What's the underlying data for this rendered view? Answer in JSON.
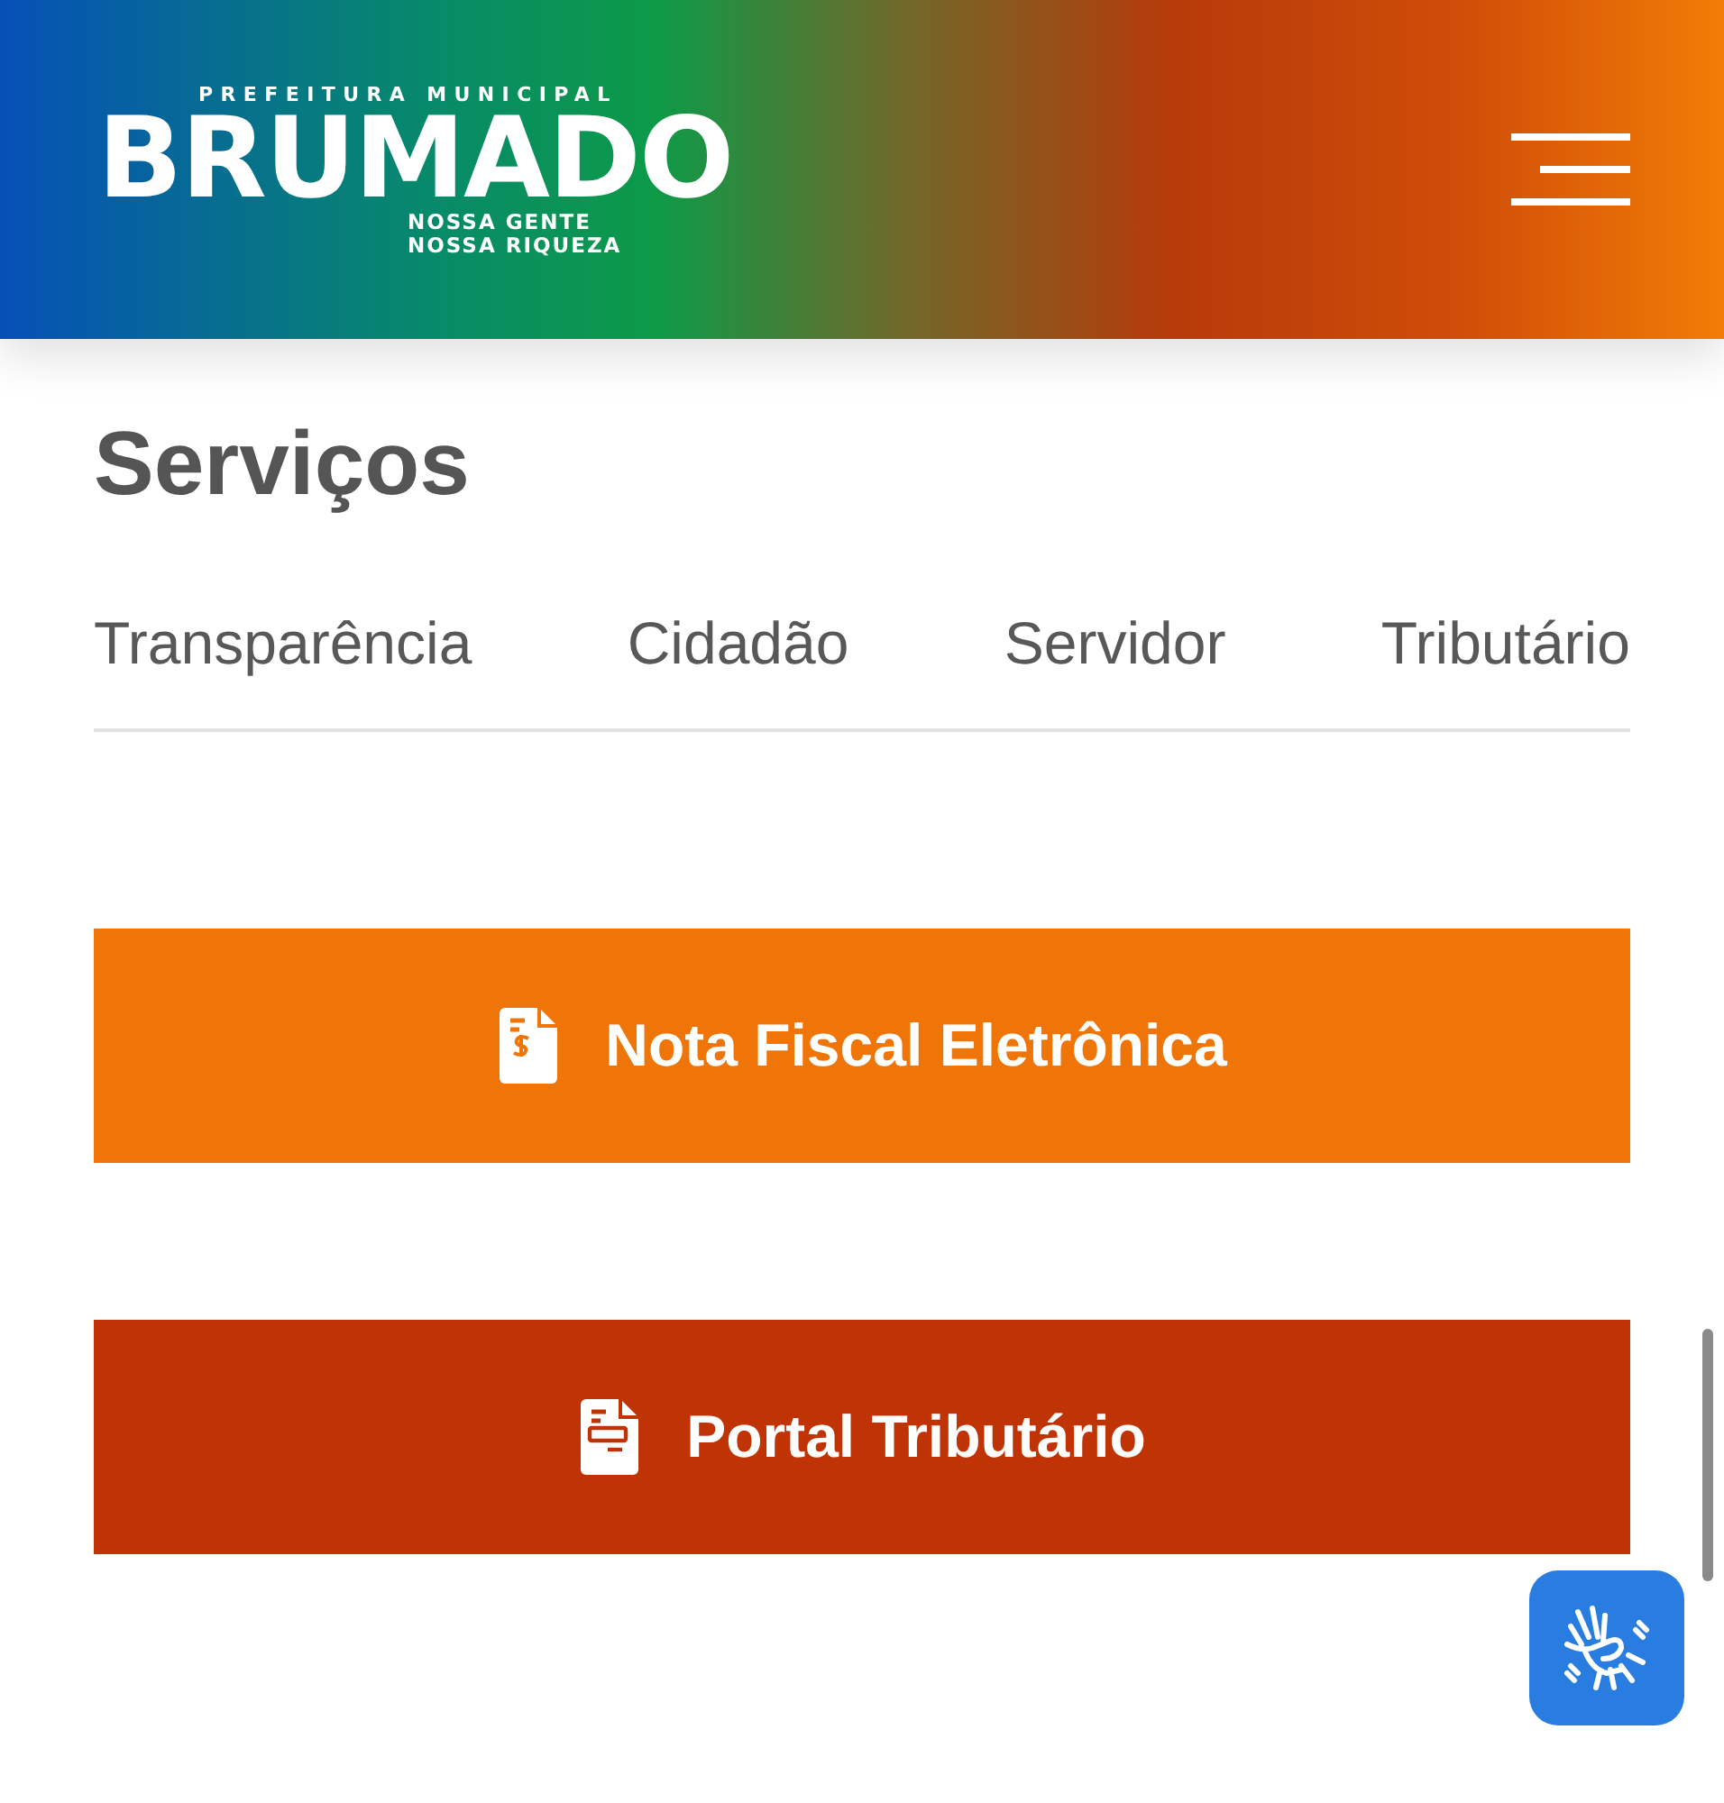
{
  "header": {
    "logo": {
      "top": "PREFEITURA MUNICIPAL",
      "name": "BRUMADO",
      "tagline": [
        "NOSSA GENTE",
        "NOSSA RIQUEZA"
      ]
    }
  },
  "section": {
    "title": "Serviços",
    "tabs": [
      {
        "label": "Transparência"
      },
      {
        "label": "Cidadão"
      },
      {
        "label": "Servidor"
      },
      {
        "label": "Tributário"
      }
    ],
    "services": [
      {
        "label": "Nota Fiscal Eletrônica",
        "kind": "invoice",
        "color": "#f07508"
      },
      {
        "label": "Portal Tributário",
        "kind": "form",
        "color": "#bf3305"
      }
    ]
  }
}
